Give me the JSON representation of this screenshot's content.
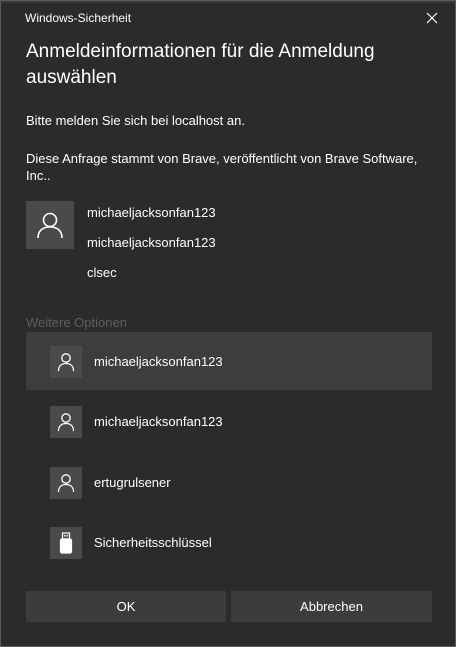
{
  "window": {
    "title": "Windows-Sicherheit"
  },
  "heading": "Anmeldeinformationen für die Anmeldung auswählen",
  "messages": {
    "sign_in": "Bitte melden Sie sich bei localhost an.",
    "request_source": "Diese Anfrage stammt von Brave, veröffentlicht von Brave Software, Inc.."
  },
  "credential": {
    "icon": "person-icon",
    "line1": "michaeljacksonfan123",
    "line2": "michaeljacksonfan123",
    "line3": "clsec"
  },
  "more_options": {
    "label": "Weitere Optionen",
    "items": [
      {
        "label": "michaeljacksonfan123",
        "icon": "person-icon",
        "selected": true
      },
      {
        "label": "michaeljacksonfan123",
        "icon": "person-icon",
        "selected": false
      },
      {
        "label": "ertugrulsener",
        "icon": "person-icon",
        "selected": false
      },
      {
        "label": "Sicherheitsschlüssel",
        "icon": "usb-key-icon",
        "selected": false
      }
    ]
  },
  "buttons": {
    "ok": "OK",
    "cancel": "Abbrechen"
  },
  "colors": {
    "background": "#2b2b2b",
    "selected_row": "#3d3d3d",
    "icon_tile": "#4a4a4a",
    "button": "#3c3c3c",
    "muted_text": "#5f5f5f"
  }
}
